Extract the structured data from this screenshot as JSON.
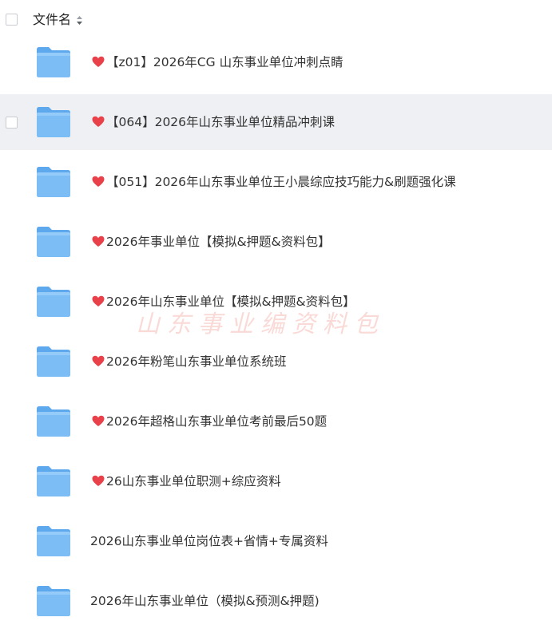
{
  "header": {
    "column_title": "文件名",
    "sort_icon": "sort-arrows-icon"
  },
  "watermark": "山东事业编资料包",
  "colors": {
    "hover_row_bg": "#eff0f3",
    "heart": "#e8414a",
    "folder_blue": "#6fb3f0",
    "watermark": "#f0968c"
  },
  "rows": [
    {
      "name": "【z01】2026年CG 山东事业单位冲刺点睛",
      "heart": true,
      "hovered": false
    },
    {
      "name": "【064】2026年山东事业单位精品冲刺课",
      "heart": true,
      "hovered": true
    },
    {
      "name": "【051】2026年山东事业单位王小晨综应技巧能力&刷题强化课",
      "heart": true,
      "hovered": false
    },
    {
      "name": "2026年事业单位【模拟&押题&资料包】",
      "heart": true,
      "hovered": false
    },
    {
      "name": "2026年山东事业单位【模拟&押题&资料包】",
      "heart": true,
      "hovered": false
    },
    {
      "name": "2026年粉笔山东事业单位系统班",
      "heart": true,
      "hovered": false
    },
    {
      "name": "2026年超格山东事业单位考前最后50题",
      "heart": true,
      "hovered": false
    },
    {
      "name": " 26山东事业单位职测+综应资料",
      "heart": true,
      "hovered": false
    },
    {
      "name": "2026山东事业单位岗位表+省情+专属资料",
      "heart": false,
      "hovered": false
    },
    {
      "name": "2026年山东事业单位（模拟&预测&押题)",
      "heart": false,
      "hovered": false
    }
  ]
}
